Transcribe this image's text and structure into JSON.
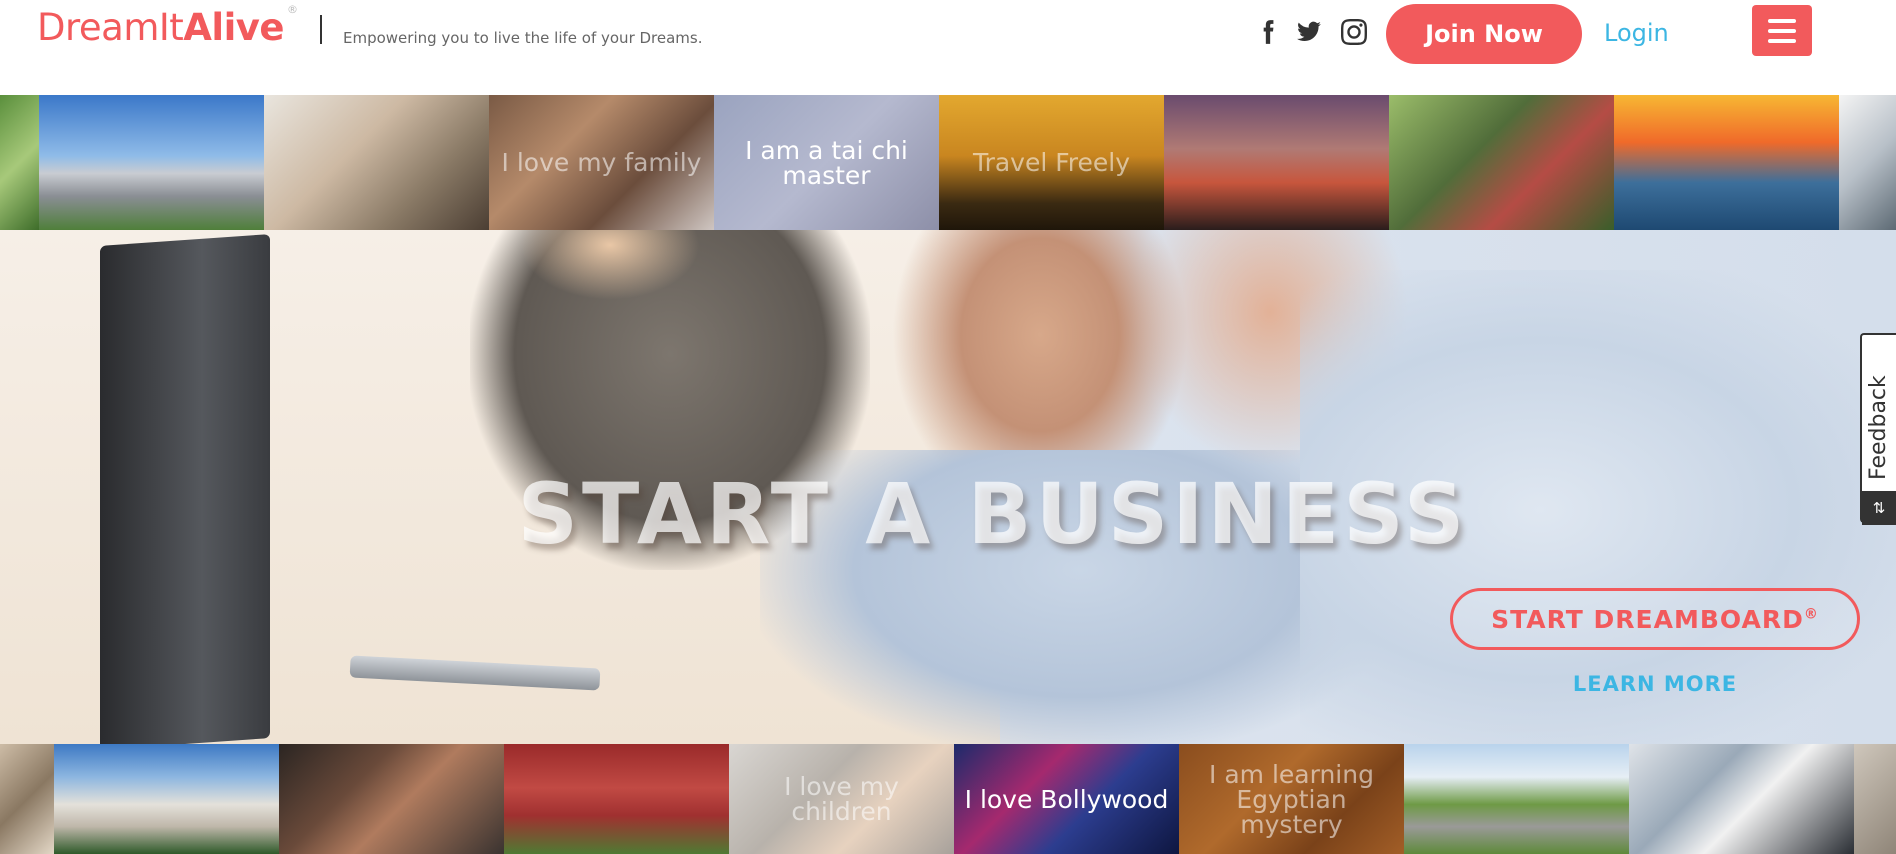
{
  "header": {
    "logo_text_regular": "DreamIt",
    "logo_text_bold": "Alive",
    "logo_mark": "®",
    "tagline": "Empowering you to live the life of your Dreams.",
    "social": [
      "facebook-icon",
      "twitter-icon",
      "instagram-icon"
    ],
    "join_label": "Join Now",
    "login_label": "Login",
    "menu_icon": "hamburger-menu-icon"
  },
  "top_tiles": [
    {
      "caption": ""
    },
    {
      "caption": ""
    },
    {
      "caption": ""
    },
    {
      "caption": "I love my family"
    },
    {
      "caption": "I am a tai chi master"
    },
    {
      "caption": "Travel Freely"
    },
    {
      "caption": ""
    },
    {
      "caption": ""
    },
    {
      "caption": ""
    },
    {
      "caption": ""
    }
  ],
  "hero": {
    "title": "START A BUSINESS",
    "dreamboard_label": "START DREAMBOARD",
    "dreamboard_mark": "®",
    "learn_more_label": "LEARN MORE"
  },
  "bottom_tiles": [
    {
      "caption": ""
    },
    {
      "caption": ""
    },
    {
      "caption": ""
    },
    {
      "caption": ""
    },
    {
      "caption": "I love my children"
    },
    {
      "caption": "I love Bollywood"
    },
    {
      "caption": "I am learning Egyptian mystery"
    },
    {
      "caption": ""
    },
    {
      "caption": ""
    },
    {
      "caption": ""
    }
  ],
  "feedback": {
    "label": "Feedback",
    "icon": "sort-arrows-icon"
  },
  "colors": {
    "brand": "#f25a5c",
    "link": "#3cb6e3"
  }
}
